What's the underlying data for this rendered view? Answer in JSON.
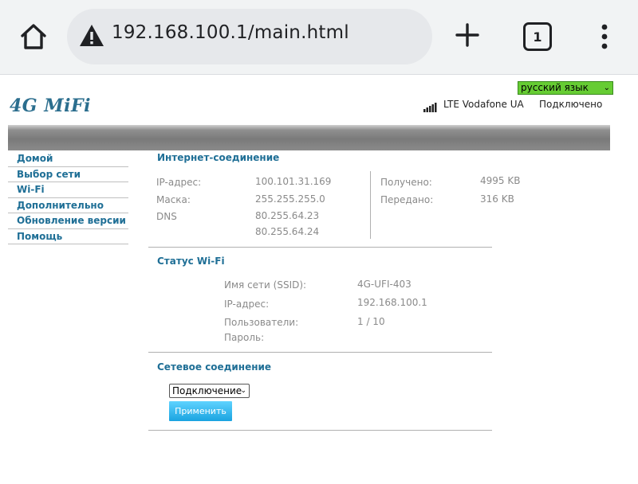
{
  "browser": {
    "url": "192.168.100.1/main.html",
    "tab_count": "1"
  },
  "header": {
    "language": "русский язык",
    "logo": "4G MiFi",
    "network": "LTE Vodafone UA",
    "status": "Подключено"
  },
  "sidebar": {
    "items": [
      {
        "label": "Домой"
      },
      {
        "label": "Выбор сети"
      },
      {
        "label": "Wi-Fi"
      },
      {
        "label": "Дополнительно"
      },
      {
        "label": "Обновление версии"
      },
      {
        "label": "Помощь"
      }
    ]
  },
  "internet": {
    "title": "Интернет-соединение",
    "ip_label": "IP-адрес:",
    "ip_value": "100.101.31.169",
    "mask_label": "Маска:",
    "mask_value": "255.255.255.0",
    "dns_label": "DNS",
    "dns1": "80.255.64.23",
    "dns2": "80.255.64.24",
    "received_label": "Получено:",
    "received_value": "4995 KB",
    "sent_label": "Передано:",
    "sent_value": "316 KB"
  },
  "wifi": {
    "title": "Статус Wi-Fi",
    "ssid_label": "Имя сети (SSID):",
    "ssid_value": "4G-UFI-403",
    "ip_label": "IP-адрес:",
    "ip_value": "192.168.100.1",
    "users_label": "Пользователи:",
    "users_value": "1 / 10",
    "password_label": "Пароль:"
  },
  "network_conn": {
    "title": "Сетевое соединение",
    "selected": "Подключение",
    "apply_label": "Применить"
  }
}
